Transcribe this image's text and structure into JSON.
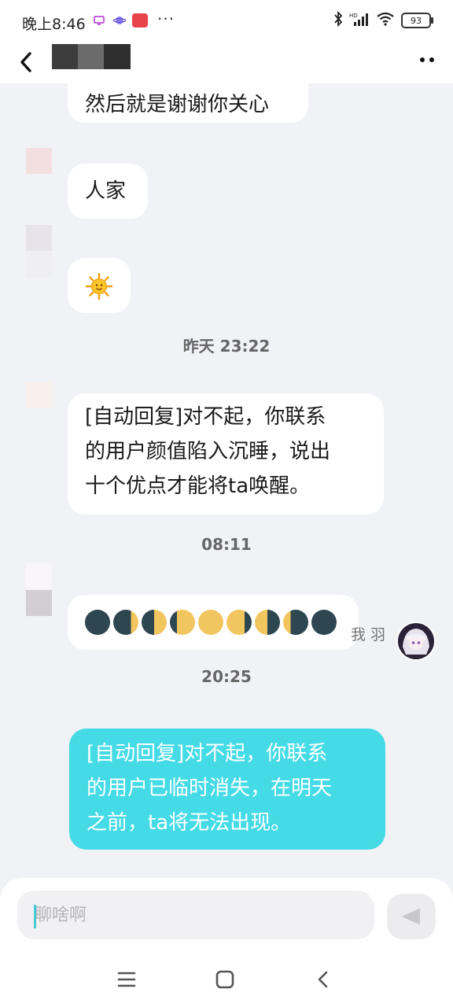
{
  "status_bar": {
    "time": "晚上8:46",
    "dots": "···",
    "battery": "93",
    "icons": [
      "app-tv-icon",
      "app-planet-icon",
      "app-red-icon",
      "bluetooth-icon",
      "hd-signal-icon",
      "wifi-icon",
      "battery-icon"
    ]
  },
  "header": {
    "back_icon": "chevron-left-icon",
    "contact_name": "",
    "more_icon": "more-dots-icon"
  },
  "messages": [
    {
      "side": "them",
      "text": "然后就是谢谢你关心"
    },
    {
      "side": "them",
      "text": "人家"
    },
    {
      "side": "them",
      "text": "🌞"
    },
    {
      "side": "time",
      "text": "昨天 23:22"
    },
    {
      "side": "them",
      "lines": [
        "[自动回复]对不起，你联系",
        "的用户颜值陷入沉睡，说出",
        "十个优点才能将ta唤醒。"
      ]
    },
    {
      "side": "time",
      "text": "08:11"
    },
    {
      "side": "them",
      "text": "🌑🌒🌓🌔🌕🌖🌗🌘🌑"
    },
    {
      "side": "time",
      "text": "20:25"
    },
    {
      "side": "me",
      "sender": "我 羽",
      "lines": [
        "[自动回复]对不起，你联系",
        "的用户已临时消失，在明天",
        "之前，ta将无法出现。"
      ]
    }
  ],
  "input": {
    "placeholder": "聊啥啊",
    "send_icon": "send-triangle-icon"
  },
  "colors": {
    "my_bubble": "#45dbe6",
    "their_bubble": "#ffffff",
    "background": "#f1f2f6",
    "cursor": "#44c9d6"
  },
  "nav": [
    "menu-icon",
    "home-square-icon",
    "back-chevron-icon"
  ]
}
